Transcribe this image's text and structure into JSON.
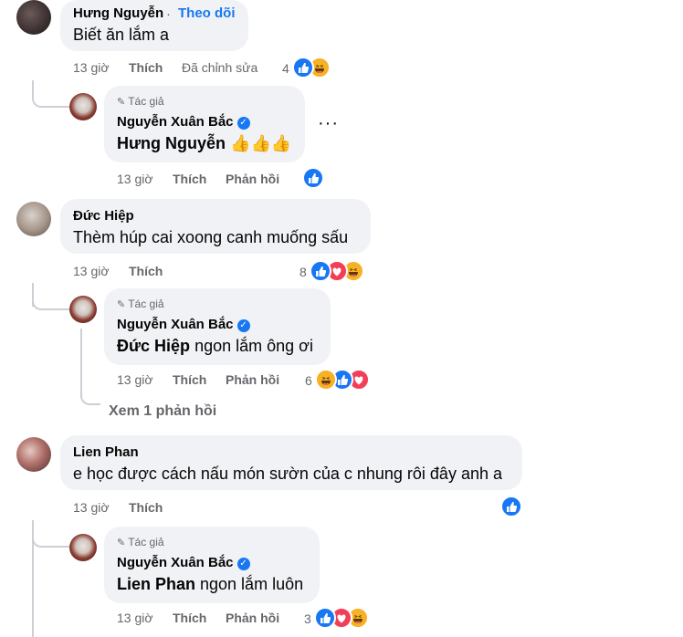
{
  "comments": [
    {
      "author": "Hưng Nguyễn",
      "follow_separator": "·",
      "follow_label": "Theo dõi",
      "text": "Biết ăn lắm a",
      "time": "13 giờ",
      "like_label": "Thích",
      "edited_label": "Đã chỉnh sửa",
      "reaction_count": "4",
      "reactions": [
        "like-icon",
        "haha-icon"
      ],
      "reply": {
        "author_badge": "Tác giả",
        "author": "Nguyễn Xuân Bắc",
        "mention": "Hưng Nguyễn",
        "text": " 👍👍👍",
        "time": "13 giờ",
        "like_label": "Thích",
        "reply_label": "Phản hồi",
        "reaction_count": "",
        "reactions": [
          "like-icon"
        ]
      }
    },
    {
      "author": "Đức Hiệp",
      "text": "Thèm húp cai xoong canh muống sấu",
      "time": "13 giờ",
      "like_label": "Thích",
      "reaction_count": "8",
      "reactions": [
        "like-icon",
        "love-icon",
        "haha-icon"
      ],
      "reply": {
        "author_badge": "Tác giả",
        "author": "Nguyễn Xuân Bắc",
        "mention": "Đức Hiệp",
        "text": " ngon lắm ông ơi",
        "time": "13 giờ",
        "like_label": "Thích",
        "reply_label": "Phản hồi",
        "reaction_count": "6",
        "reactions": [
          "haha-icon",
          "like-icon",
          "love-icon"
        ]
      },
      "view_replies": "Xem 1 phản hồi"
    },
    {
      "author": "Lien Phan",
      "text": "e học được cách nấu món sườn của c nhung rôi đây anh a",
      "time": "13 giờ",
      "like_label": "Thích",
      "reaction_count": "",
      "reactions": [
        "like-icon"
      ],
      "reply": {
        "author_badge": "Tác giả",
        "author": "Nguyễn Xuân Bắc",
        "mention": "Lien Phan",
        "text": " ngon lắm luôn",
        "time": "13 giờ",
        "like_label": "Thích",
        "reply_label": "Phản hồi",
        "reaction_count": "3",
        "reactions": [
          "like-icon",
          "love-icon",
          "haha-icon"
        ]
      }
    }
  ],
  "more_options_label": "···",
  "colors": {
    "bubble": "#f0f2f5",
    "meta": "#65676b",
    "link": "#1877f2",
    "like": "#1877f2",
    "love": "#f33e58",
    "haha": "#f7b125"
  }
}
